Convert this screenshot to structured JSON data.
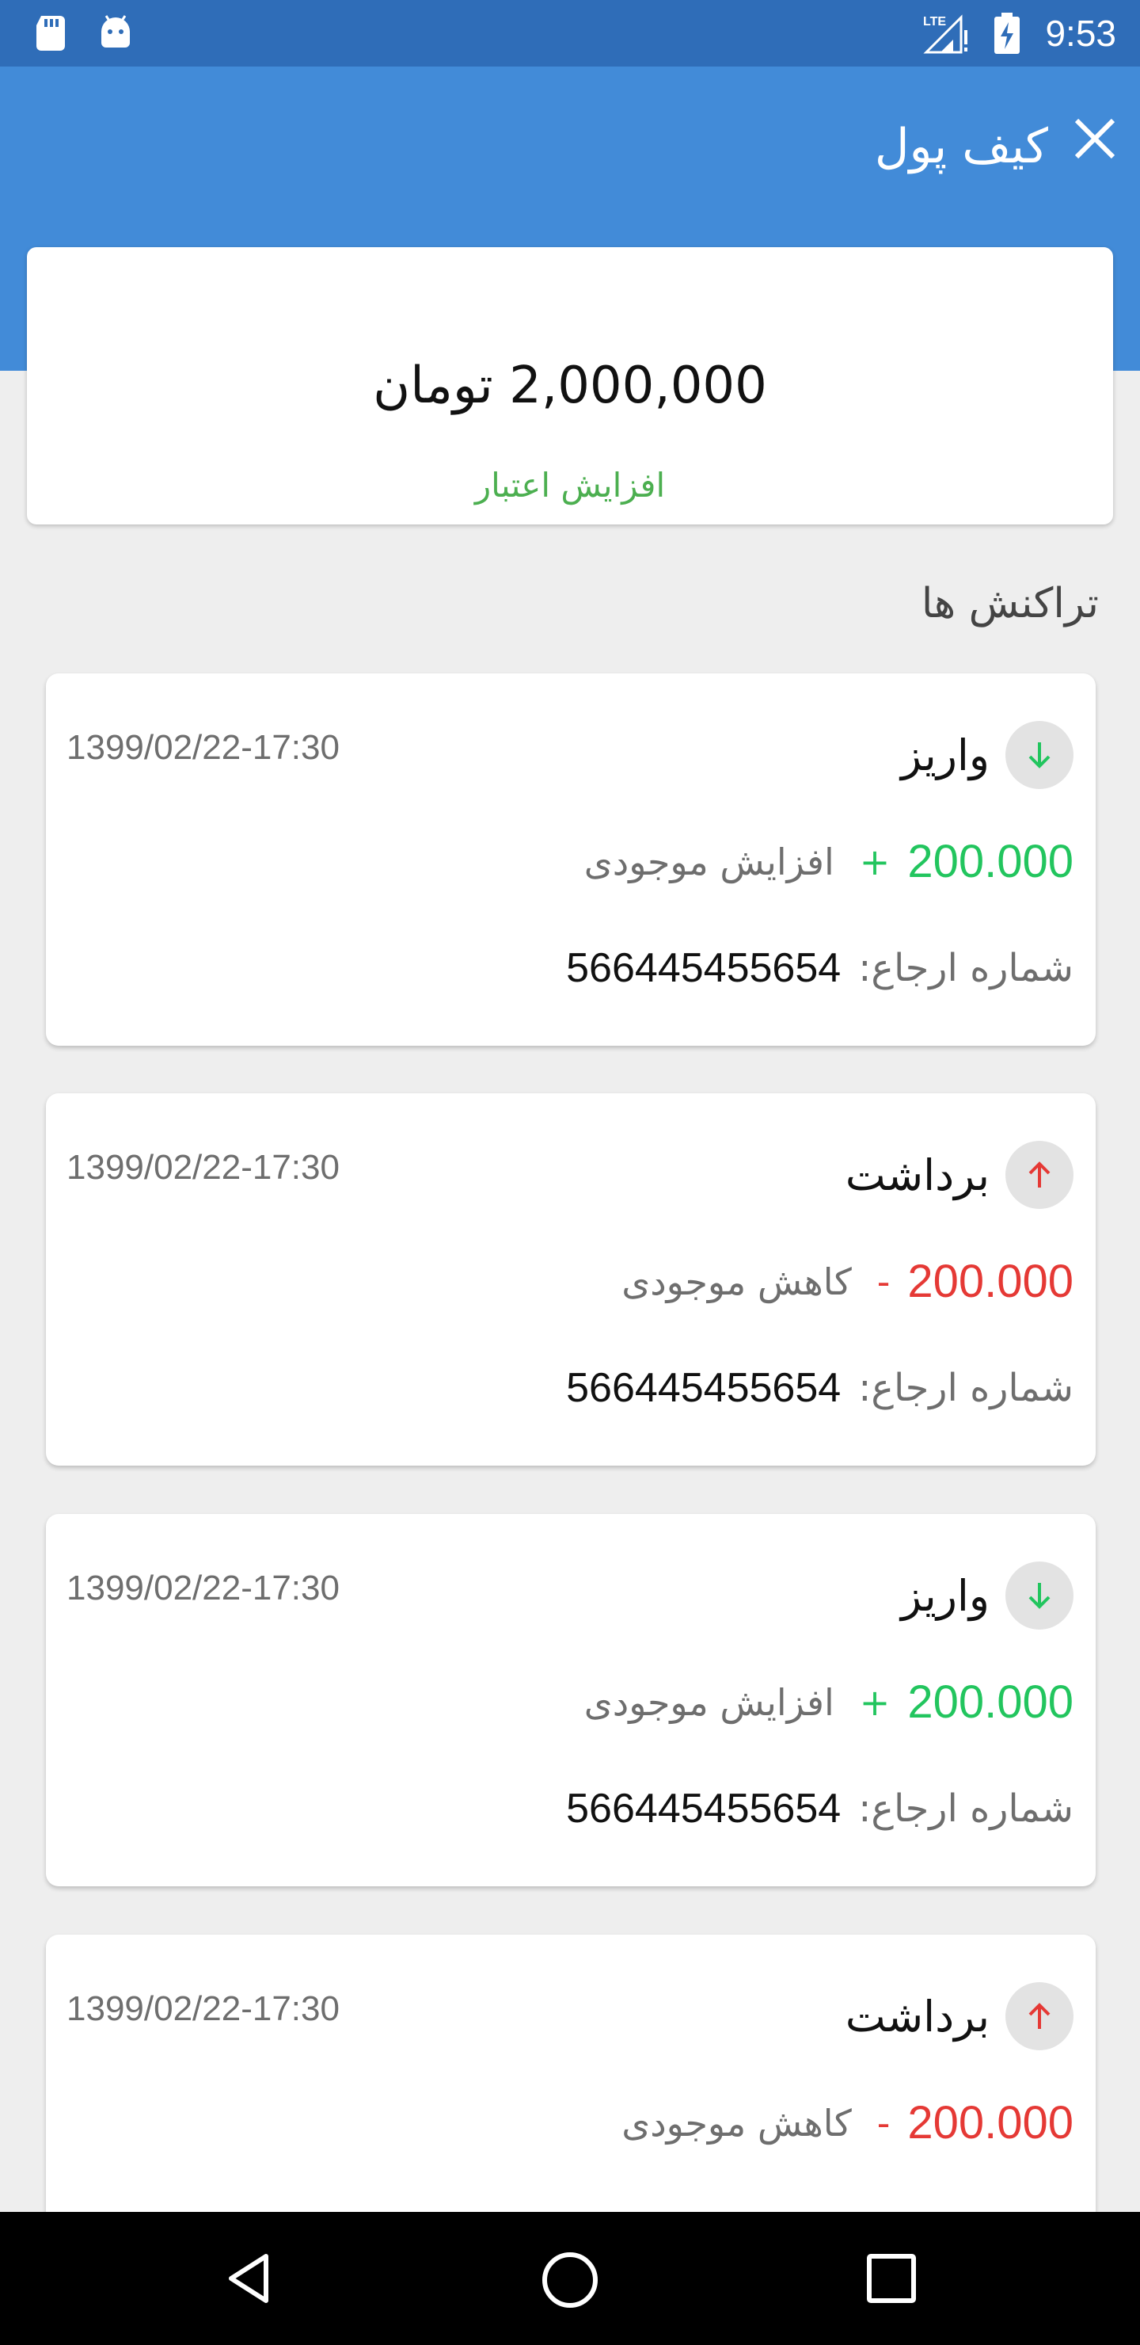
{
  "status_bar": {
    "time": "9:53",
    "network": "LTE",
    "icons": [
      "sd-card-icon",
      "android-icon",
      "signal-icon",
      "battery-charging-icon"
    ]
  },
  "app_bar": {
    "title": "کیف پول",
    "close_icon": "close-icon",
    "color": "#428bd8"
  },
  "balance": {
    "amount": "2,000,000 تومان",
    "topup_label": "افزایش اعتبار"
  },
  "transactions_title": "تراکنش ها",
  "transactions": [
    {
      "kind": "credit",
      "type": "واریز",
      "date": "1399/02/22-17:30",
      "amount": "200.000",
      "sign": "+",
      "description": "افزایش موجودی",
      "ref_label": "شماره ارجاع:",
      "ref_value": "566445455654",
      "icon": "arrow-down-icon",
      "color": "#22c55e"
    },
    {
      "kind": "debit",
      "type": "برداشت",
      "date": "1399/02/22-17:30",
      "amount": "200.000",
      "sign": "-",
      "description": "کاهش موجودی",
      "ref_label": "شماره ارجاع:",
      "ref_value": "566445455654",
      "icon": "arrow-up-icon",
      "color": "#e53935"
    },
    {
      "kind": "credit",
      "type": "واریز",
      "date": "1399/02/22-17:30",
      "amount": "200.000",
      "sign": "+",
      "description": "افزایش موجودی",
      "ref_label": "شماره ارجاع:",
      "ref_value": "566445455654",
      "icon": "arrow-down-icon",
      "color": "#22c55e"
    },
    {
      "kind": "debit",
      "type": "برداشت",
      "date": "1399/02/22-17:30",
      "amount": "200.000",
      "sign": "-",
      "description": "کاهش موجودی",
      "icon": "arrow-up-icon",
      "color": "#e53935"
    }
  ],
  "nav_bar": {
    "buttons": [
      "back-icon",
      "home-icon",
      "recents-icon"
    ]
  }
}
